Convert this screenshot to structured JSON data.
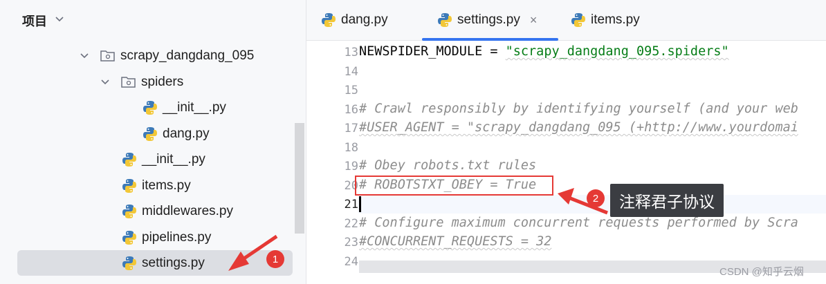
{
  "project_panel": {
    "title": "项目",
    "tree": [
      {
        "label": "scrapy_dangdang_095",
        "type": "folder",
        "expanded": true
      },
      {
        "label": "spiders",
        "type": "folder",
        "expanded": true
      },
      {
        "label": "__init__.py",
        "type": "python-file"
      },
      {
        "label": "dang.py",
        "type": "python-file"
      },
      {
        "label": "__init__.py",
        "type": "python-file"
      },
      {
        "label": "items.py",
        "type": "python-file"
      },
      {
        "label": "middlewares.py",
        "type": "python-file"
      },
      {
        "label": "pipelines.py",
        "type": "python-file"
      },
      {
        "label": "settings.py",
        "type": "python-file",
        "selected": true
      }
    ]
  },
  "editor": {
    "tabs": [
      {
        "label": "dang.py",
        "active": false
      },
      {
        "label": "settings.py",
        "active": true,
        "close": "×"
      },
      {
        "label": "items.py",
        "active": false
      }
    ],
    "line_numbers": [
      "13",
      "14",
      "15",
      "16",
      "17",
      "18",
      "19",
      "20",
      "21",
      "22",
      "23",
      "24"
    ],
    "lines": {
      "l13_a": "NEWSPIDER_MODULE = ",
      "l13_b": "\"scrapy_dangdang_095.spiders\"",
      "l16": "# Crawl responsibly by identifying yourself (and your web",
      "l17": "#USER_AGENT = \"scrapy_dangdang_095 (+http://www.yourdomai",
      "l19": "# Obey robots.txt rules",
      "l20": "# ROBOTSTXT_OBEY = True",
      "l22": "# Configure maximum concurrent requests performed by Scra",
      "l23": "#CONCURRENT_REQUESTS = 32"
    }
  },
  "annotations": {
    "badge1": "1",
    "badge2": "2",
    "tooltip": "注释君子协议",
    "accent_red": "#e53935"
  },
  "watermark": "CSDN @知乎云烟",
  "colors": {
    "active_tab_underline": "#3574f0",
    "comment": "#8c8c8c",
    "string": "#067d17"
  }
}
